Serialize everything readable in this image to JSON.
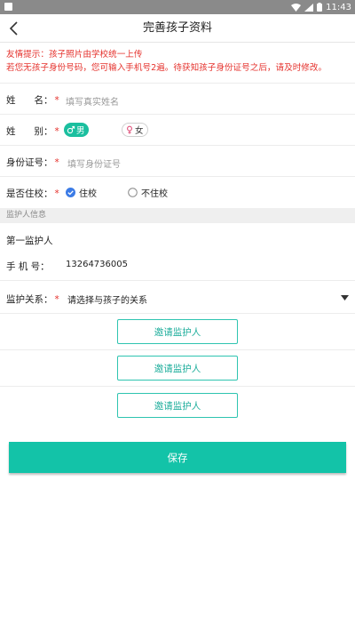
{
  "status_bar": {
    "time": "11:43"
  },
  "header": {
    "title": "完善孩子资料"
  },
  "notice": {
    "line1": "友情提示：孩子照片由学校统一上传",
    "line2": "若您无孩子身份号码，您可输入手机号2遍。待获知孩子身份证号之后，请及时修改。"
  },
  "form": {
    "name": {
      "label": "姓　　名：",
      "required": "*",
      "placeholder": "填写真实姓名"
    },
    "gender": {
      "label": "姓　　别：",
      "required": "*",
      "male": "男",
      "female": "女",
      "selected": "男"
    },
    "id_card": {
      "label": "身份证号：",
      "required": "*",
      "placeholder": "填写身份证号"
    },
    "boarding": {
      "label": "是否住校：",
      "required": "*",
      "option_yes": "住校",
      "option_no": "不住校",
      "selected": "住校"
    }
  },
  "guardian": {
    "section_title": "监护人信息",
    "first_label": "第一监护人",
    "phone_label": "手  机  号：",
    "phone_value": "13264736005",
    "relation_label": "监护关系：",
    "relation_required": "*",
    "relation_value": "请选择与孩子的关系"
  },
  "invite_buttons": [
    "邀请监护人",
    "邀请监护人",
    "邀请监护人"
  ],
  "save_label": "保存",
  "colors": {
    "accent": "#13c3a8",
    "warning": "#e5322d",
    "check": "#3b7be6"
  }
}
